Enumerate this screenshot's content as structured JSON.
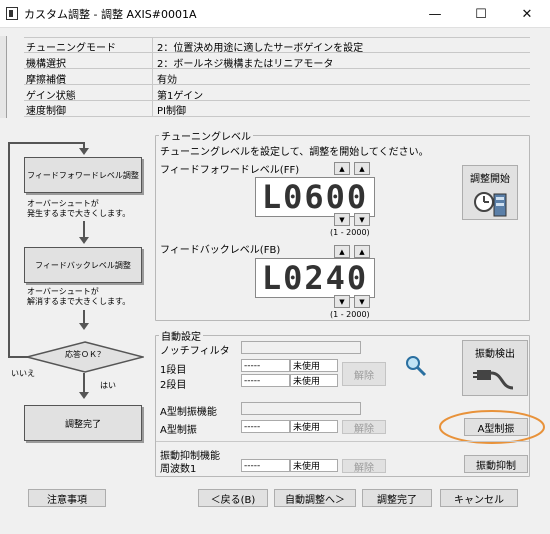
{
  "window": {
    "title": "カスタム調整 - 調整 AXIS#0001A",
    "minimize": "—",
    "maximize": "☐",
    "close": "✕"
  },
  "params": [
    {
      "label": "チューニングモード",
      "value": "2：位置決め用途に適したサーボゲインを設定"
    },
    {
      "label": "機構選択",
      "value": "2：ボールネジ機構またはリニアモータ"
    },
    {
      "label": "摩擦補償",
      "value": "有効"
    },
    {
      "label": "ゲイン状態",
      "value": "第1ゲイン"
    },
    {
      "label": "速度制御",
      "value": "PI制御"
    }
  ],
  "flow": {
    "ff_box": "フィードフォワードレベル調整",
    "ff_note1": "オーバーシュートが",
    "ff_note2": "発生するまで大きくします。",
    "fb_box": "フィードバックレベル調整",
    "fb_note1": "オーバーシュートが",
    "fb_note2": "解消するまで大きくします。",
    "decision": "応答ＯＫ？",
    "no_label": "いいえ",
    "yes_label": "はい",
    "done_box": "調整完了"
  },
  "tuning": {
    "group_label": "チューニングレベル",
    "instruction": "チューニングレベルを設定して、調整を開始してください。",
    "ff_label": "フィードフォワードレベル(FF)",
    "ff_display": "L0600",
    "ff_range": "(1 - 2000)",
    "fb_label": "フィードバックレベル(FB)",
    "fb_display": "L0240",
    "fb_range": "(1 - 2000)",
    "start_button": "調整開始"
  },
  "auto": {
    "group_label": "自動設定",
    "notch_label": "ノッチフィルタ",
    "stage1": "1段目",
    "stage2": "2段目",
    "stage1_value": "-----",
    "stage2_value": "-----",
    "stage1_status": "未使用",
    "stage2_status": "未使用",
    "release1": "解除",
    "detect_button": "振動検出",
    "a_type_label": "A型制振機能",
    "a_type_sub": "A型制振",
    "a_type_value": "-----",
    "a_type_status": "未使用",
    "release2": "解除",
    "a_type_button": "A型制振",
    "vib_label": "振動抑制機能",
    "vib_sub": "周波数1",
    "vib_value": "-----",
    "vib_status": "未使用",
    "release3": "解除",
    "vib_button": "振動抑制"
  },
  "footer": {
    "caution": "注意事項",
    "back": "＜戻る(B)",
    "auto_tune": "自動調整へ＞",
    "complete": "調整完了",
    "cancel": "キャンセル"
  },
  "colors": {
    "highlight": "#e8923a",
    "segment": "#333333"
  }
}
